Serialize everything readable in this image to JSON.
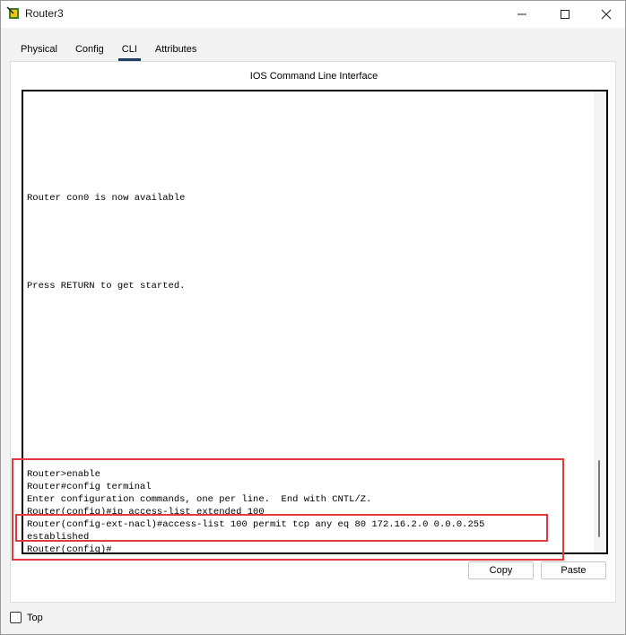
{
  "window": {
    "title": "Router3",
    "app_icon": "packet-tracer-router-icon"
  },
  "tabs": [
    {
      "label": "Physical",
      "active": false
    },
    {
      "label": "Config",
      "active": false
    },
    {
      "label": "CLI",
      "active": true
    },
    {
      "label": "Attributes",
      "active": false
    }
  ],
  "cli": {
    "heading": "IOS Command Line Interface",
    "lines": [
      "",
      "",
      "",
      "",
      "",
      "",
      "",
      "",
      "Router con0 is now available",
      "",
      "",
      "",
      "",
      "",
      "",
      "Press RETURN to get started.",
      "",
      "",
      "",
      "",
      "",
      "",
      "",
      "",
      "",
      "",
      "",
      "",
      "",
      "",
      "Router>enable",
      "Router#config terminal",
      "Enter configuration commands, one per line.  End with CNTL/Z.",
      "Router(config)#ip access-list extended 100",
      "Router(config-ext-nacl)#access-list 100 permit tcp any eq 80 172.16.2.0 0.0.0.255",
      "established",
      "Router(config)#"
    ]
  },
  "buttons": {
    "copy": "Copy",
    "paste": "Paste"
  },
  "top_checkbox": {
    "label": "Top",
    "checked": false
  },
  "colors": {
    "highlight": "#e23b3b",
    "active_tab_underline": "#1e3f66"
  }
}
